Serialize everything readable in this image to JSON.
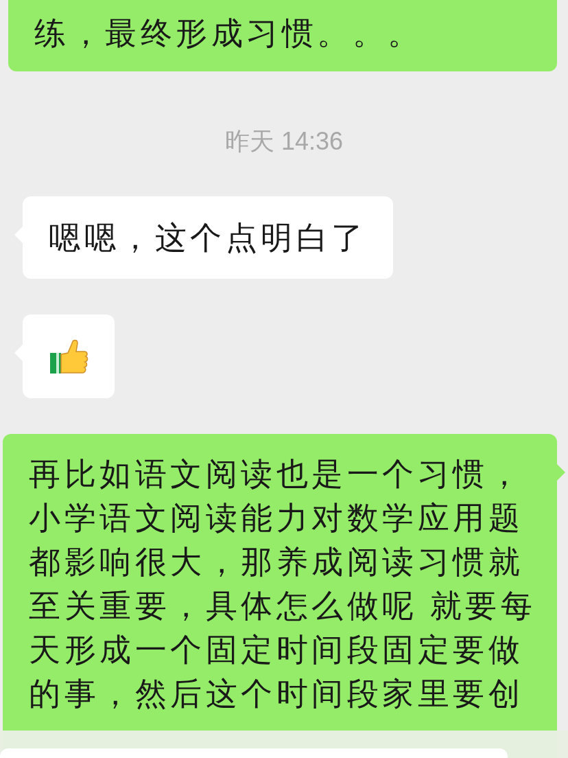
{
  "messages": [
    {
      "kind": "sent_text",
      "text": "练，最终形成习惯。。。"
    },
    {
      "kind": "time",
      "text": "昨天 14:36"
    },
    {
      "kind": "received_text",
      "text": "嗯嗯，这个点明白了"
    },
    {
      "kind": "received_emoji"
    },
    {
      "kind": "sent_text",
      "text": "再比如语文阅读也是一个习惯，小学语文阅读能力对数学应用题都影响很大，那养成阅读习惯就至关重要，具体怎么做呢 就要每天形成一个固定时间段固定要做的事，然后这个时间段家里要创"
    }
  ]
}
